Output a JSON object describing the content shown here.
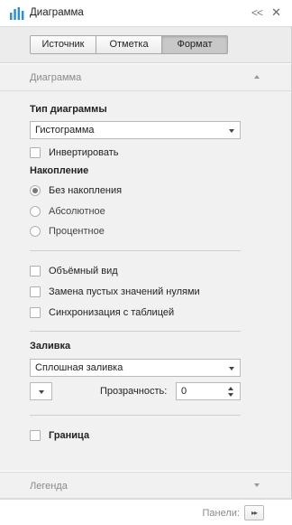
{
  "titlebar": {
    "title": "Диаграмма",
    "logo_icon": "bar-chart-icon",
    "collapse_glyph": "<<",
    "close_glyph": "✕"
  },
  "tabs": [
    {
      "label": "Источник",
      "active": false
    },
    {
      "label": "Отметка",
      "active": false
    },
    {
      "label": "Формат",
      "active": true
    }
  ],
  "diagram_section": {
    "header": "Диаграмма",
    "chart_type_label": "Тип диаграммы",
    "chart_type_value": "Гистограмма",
    "invert_label": "Инвертировать",
    "invert_checked": false,
    "stacking_label": "Накопление",
    "stacking_options": [
      {
        "label": "Без накопления",
        "checked": true
      },
      {
        "label": "Абсолютное",
        "checked": false
      },
      {
        "label": "Процентное",
        "checked": false
      }
    ],
    "options": [
      {
        "label": "Объёмный вид",
        "checked": false
      },
      {
        "label": "Замена пустых значений нулями",
        "checked": false
      },
      {
        "label": "Синхронизация с таблицей",
        "checked": false
      }
    ],
    "fill_label": "Заливка",
    "fill_value": "Сплошная заливка",
    "transparency_label": "Прозрачность:",
    "transparency_value": "0",
    "border_label": "Граница",
    "border_checked": false
  },
  "legend_section": {
    "header": "Легенда"
  },
  "footer": {
    "panels_label": "Панели:",
    "panels_button_glyph": "▸▸"
  },
  "colors": {
    "logo_blue": "#2a8fd8",
    "panel_bg": "#f1f1f1",
    "active_tab": "#c8c8c8"
  }
}
